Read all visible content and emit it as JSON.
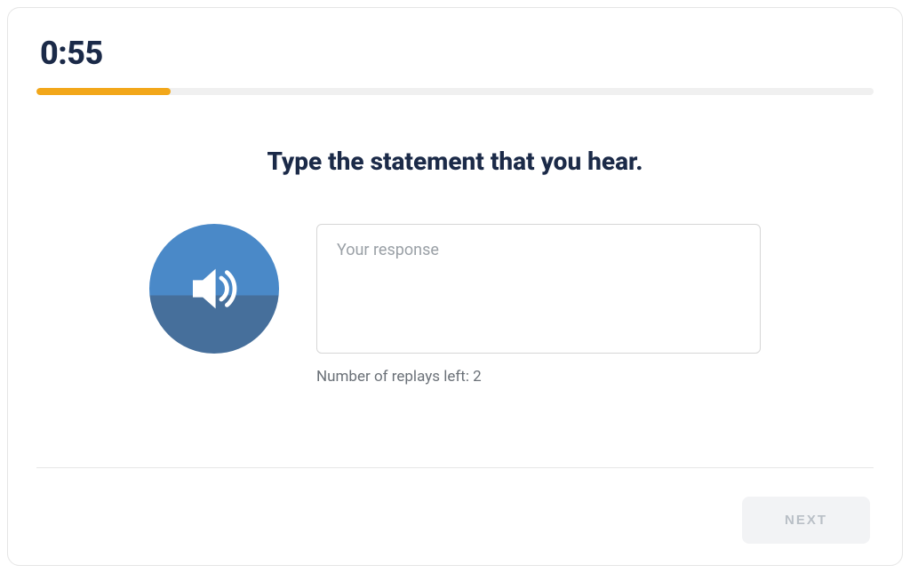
{
  "timer": "0:55",
  "progress_percent": 16,
  "prompt": "Type the statement that you hear.",
  "response": {
    "value": "",
    "placeholder": "Your response"
  },
  "replays_text": "Number of replays left: 2",
  "next_label": "NEXT",
  "colors": {
    "accent": "#f2a71a",
    "dark_text": "#1b2a48",
    "audio_top": "#4a89c8",
    "audio_bottom": "#466f9b"
  }
}
